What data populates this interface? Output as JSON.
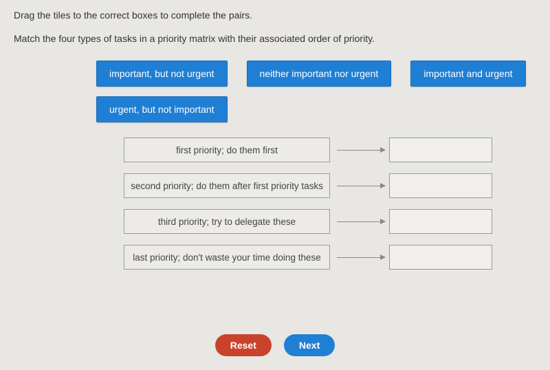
{
  "instructions": {
    "line1": "Drag the tiles to the correct boxes to complete the pairs.",
    "line2": "Match the four types of tasks in a priority matrix with their associated order of priority."
  },
  "tiles": [
    "important, but not urgent",
    "neither important nor urgent",
    "important and urgent",
    "urgent, but not important"
  ],
  "pairs": [
    {
      "label": "first priority; do them first"
    },
    {
      "label": "second priority; do them after first priority tasks"
    },
    {
      "label": "third priority; try to delegate these"
    },
    {
      "label": "last priority; don't waste your time doing these"
    }
  ],
  "buttons": {
    "reset": "Reset",
    "next": "Next"
  }
}
